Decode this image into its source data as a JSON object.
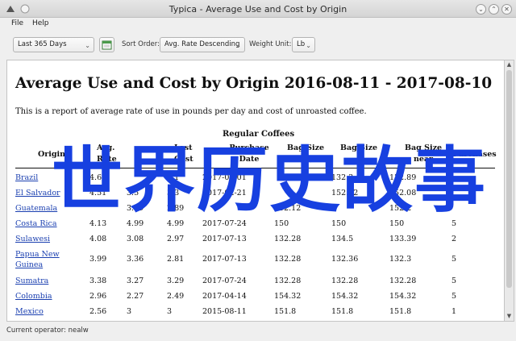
{
  "window": {
    "title": "Typica - Average Use and Cost by Origin"
  },
  "menu": {
    "items": [
      "File",
      "Help"
    ]
  },
  "toolbar": {
    "date_range": "Last 365 Days",
    "sort_label": "Sort Order:",
    "sort_value": "Avg. Rate Descending",
    "weight_label": "Weight Unit:",
    "weight_value": "Lb"
  },
  "report": {
    "title": "Average Use and Cost by Origin 2016-08-11 - 2017-08-10",
    "description": "This is a report of average rate of use in pounds per day and cost of unroasted coffee.",
    "section": "Regular Coffees",
    "headers": {
      "origin": "Origin",
      "avg_rate_1": "Avg.",
      "avg_rate_2": "Rate",
      "last_cost_1": "Last",
      "last_cost_2": "Cost",
      "purchase_1": "Purchase",
      "purchase_2": "Date",
      "bag_size_1": "Bag Size",
      "bag_size_2": "(lb)",
      "bag_size_b_1": "Bag Size",
      "bag_size_c_1": "Bag Size",
      "bag_size_c_2": "near",
      "purchases": "Purchases"
    },
    "rows": [
      {
        "origin": "Brazil",
        "rate": "4.67",
        "c1": "",
        "c2": "3.1",
        "date": "2017-07-01",
        "b1": "",
        "b2": "132.3",
        "b3": "132.89",
        "p": ""
      },
      {
        "origin": "El Salvador",
        "rate": "4.51",
        "c1": "3.5",
        "c2": "3.3",
        "date": "2017-02-21",
        "b1": "",
        "b2": "152.62",
        "b3": "152.08",
        "p": ""
      },
      {
        "origin": "Guatemala",
        "rate": "",
        "c1": "3.99",
        "c2": "2.89",
        "date": "",
        "b1": "152.12",
        "b2": "",
        "b3": "152.2",
        "p": ""
      },
      {
        "origin": "Costa Rica",
        "rate": "4.13",
        "c1": "4.99",
        "c2": "4.99",
        "date": "2017-07-24",
        "b1": "150",
        "b2": "150",
        "b3": "150",
        "p": "5"
      },
      {
        "origin": "Sulawesi",
        "rate": "4.08",
        "c1": "3.08",
        "c2": "2.97",
        "date": "2017-07-13",
        "b1": "132.28",
        "b2": "134.5",
        "b3": "133.39",
        "p": "2"
      },
      {
        "origin": "Papua New Guinea",
        "origin_l1": "Papua New",
        "origin_l2": "Guinea",
        "rate": "3.99",
        "c1": "3.36",
        "c2": "2.81",
        "date": "2017-07-13",
        "b1": "132.28",
        "b2": "132.36",
        "b3": "132.3",
        "p": "5"
      },
      {
        "origin": "Sumatra",
        "rate": "3.38",
        "c1": "3.27",
        "c2": "3.29",
        "date": "2017-07-24",
        "b1": "132.28",
        "b2": "132.28",
        "b3": "132.28",
        "p": "5"
      },
      {
        "origin": "Colombia",
        "rate": "2.96",
        "c1": "2.27",
        "c2": "2.49",
        "date": "2017-04-14",
        "b1": "154.32",
        "b2": "154.32",
        "b3": "154.32",
        "p": "5"
      },
      {
        "origin": "Mexico",
        "rate": "2.56",
        "c1": "3",
        "c2": "3",
        "date": "2015-08-11",
        "b1": "151.8",
        "b2": "151.8",
        "b3": "151.8",
        "p": "1"
      }
    ],
    "watermark_text": "世界历史故事"
  },
  "status": {
    "text": "Current operator: nealw"
  },
  "colors": {
    "link": "#1a3fb0",
    "watermark": "#1740e0"
  }
}
